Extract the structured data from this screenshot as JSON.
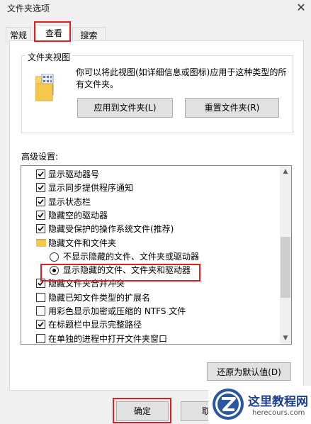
{
  "window": {
    "title": "文件夹选项",
    "close_glyph": "✕"
  },
  "tabs": [
    {
      "label": "常规",
      "active": false
    },
    {
      "label": "查看",
      "active": true
    },
    {
      "label": "搜索",
      "active": false
    }
  ],
  "folder_views": {
    "title": "文件夹视图",
    "description": "你可以将此视图(如详细信息或图标)应用于这种类型的所有文件夹。",
    "apply_button": "应用到文件夹(L)",
    "reset_button": "重置文件夹(R)"
  },
  "advanced": {
    "label": "高级设置:",
    "items": [
      {
        "type": "checkbox",
        "checked": true,
        "label": "显示驱动器号"
      },
      {
        "type": "checkbox",
        "checked": true,
        "label": "显示同步提供程序通知"
      },
      {
        "type": "checkbox",
        "checked": true,
        "label": "显示状态栏"
      },
      {
        "type": "checkbox",
        "checked": true,
        "label": "隐藏空的驱动器"
      },
      {
        "type": "checkbox",
        "checked": true,
        "label": "隐藏受保护的操作系统文件(推荐)"
      },
      {
        "type": "folder",
        "label": "隐藏文件和文件夹"
      },
      {
        "type": "radio",
        "selected": false,
        "label": "不显示隐藏的文件、文件夹或驱动器"
      },
      {
        "type": "radio",
        "selected": true,
        "label": "显示隐藏的文件、文件夹和驱动器"
      },
      {
        "type": "checkbox",
        "checked": true,
        "label": "隐藏文件夹合并冲突"
      },
      {
        "type": "checkbox",
        "checked": false,
        "label": "隐藏已知文件类型的扩展名"
      },
      {
        "type": "checkbox",
        "checked": false,
        "label": "用彩色显示加密或压缩的 NTFS 文件"
      },
      {
        "type": "checkbox",
        "checked": true,
        "label": "在标题栏中显示完整路径"
      },
      {
        "type": "checkbox",
        "checked": false,
        "label": "在单独的进程中打开文件夹窗口"
      }
    ],
    "restore_button": "还原为默认值(D)"
  },
  "footer": {
    "ok_button": "确定",
    "cancel_button": "取"
  },
  "watermark": {
    "text": "这里教程网",
    "url": "herecours.com"
  }
}
